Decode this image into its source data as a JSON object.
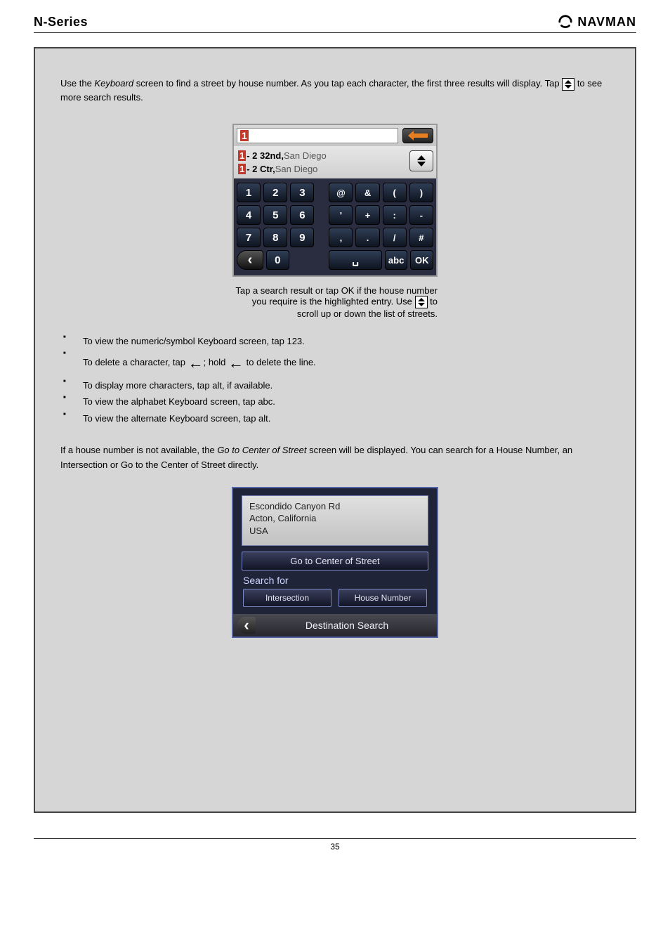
{
  "header": {
    "left": "N-Series",
    "right": "NAVMAN"
  },
  "section1": {
    "line1_prefix": "Use the ",
    "line1_bold": "Keyboard",
    "line1_mid": " screen to find a street by house number. As you tap each character, the first three results will display. Tap ",
    "line1_suffix": " to see more search results."
  },
  "keypad": {
    "input": "1",
    "backspace": "←",
    "results": [
      {
        "match": "1",
        "rest": " - 2 32nd,",
        "tail": " San Diego"
      },
      {
        "match": "1",
        "rest": " - 2 Ctr,",
        "tail": " San Diego"
      }
    ],
    "rows": [
      [
        "1",
        "2",
        "3",
        "",
        "@",
        "&",
        "(",
        ")"
      ],
      [
        "4",
        "5",
        "6",
        "",
        "'",
        "+",
        ":",
        "-"
      ],
      [
        "7",
        "8",
        "9",
        "",
        ",",
        ".",
        "/",
        "#"
      ]
    ],
    "lastrow": {
      "back": "‹",
      "zero": "0",
      "space": "␣",
      "abc": "abc",
      "ok": "OK"
    }
  },
  "postkey_text": "Tap a search result or tap OK if the house number you require is the highlighted entry. Use ",
  "postkey_suffix": " to scroll up or down the list of streets.",
  "bullets": [
    {
      "t": "To view the numeric/symbol Keyboard screen, tap 123."
    },
    {
      "pre": "To delete a character, tap ",
      "arrow": "←",
      "post": "; hold ",
      "arrow2": "←",
      "tail": " to delete the line."
    },
    {
      "t": "To display more characters, tap alt, if available."
    },
    {
      "t": "To view the alphabet Keyboard screen, tap abc."
    },
    {
      "t": "To view the alternate Keyboard screen, tap alt."
    }
  ],
  "para_lead": "If a house number is not available, the ",
  "para_emph": "Go to Center of Street",
  "para_tail": " screen will be displayed. You can search for a House Number, an Intersection or Go to the Center of Street directly.",
  "gps2": {
    "addr_l1": "Escondido Canyon Rd",
    "addr_l2": "Acton, California",
    "addr_l3": "USA",
    "btn_center": "Go to Center of Street",
    "search_label": "Search for",
    "btn_intersection": "Intersection",
    "btn_house": "House Number",
    "footer": "Destination Search",
    "chev": "‹"
  },
  "footer": "35"
}
